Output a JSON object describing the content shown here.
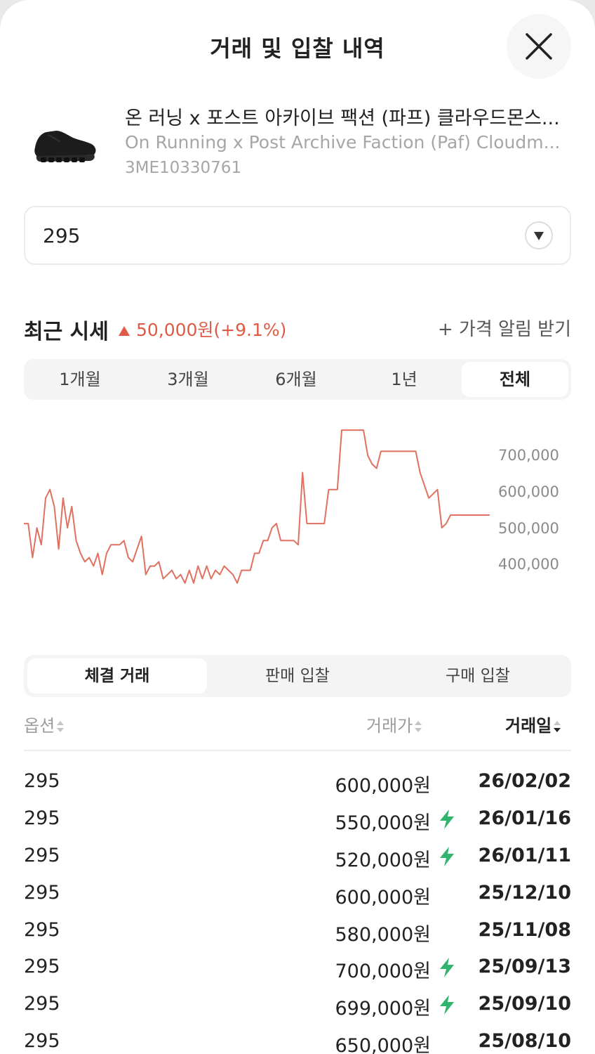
{
  "header": {
    "title": "거래 및 입찰 내역",
    "close_icon": "close-icon"
  },
  "product": {
    "name_ko": "온 러닝 x 포스트 아카이브 팩션 (파프) 클라우드몬스...",
    "name_en": "On Running x Post Archive Faction (Paf) Cloudm...",
    "model_code": "3ME10330761",
    "image": "black-running-shoe"
  },
  "size_select": {
    "value": "295",
    "icon": "chevron-down-icon"
  },
  "market": {
    "label": "최근 시세",
    "change_icon": "triangle-up-icon",
    "change": "50,000원(+9.1%)",
    "change_color": "#e05a45",
    "alert_link": "+ 가격 알림 받기"
  },
  "period_tabs": [
    {
      "label": "1개월",
      "active": false
    },
    {
      "label": "3개월",
      "active": false
    },
    {
      "label": "6개월",
      "active": false
    },
    {
      "label": "1년",
      "active": false
    },
    {
      "label": "전체",
      "active": true
    }
  ],
  "chart_data": {
    "type": "line",
    "y_ticks": [
      "700,000",
      "600,000",
      "500,000",
      "400,000"
    ],
    "ylim": [
      330000,
      760000
    ],
    "color": "#e07060",
    "x": [
      0,
      1,
      2,
      3,
      4,
      5,
      6,
      7,
      8,
      9,
      10,
      11,
      12,
      13,
      14,
      15,
      16,
      17,
      18,
      19,
      20,
      21,
      22,
      23,
      24,
      25,
      26,
      27,
      28,
      29,
      30,
      31,
      32,
      33,
      34,
      35,
      36,
      37,
      38,
      39,
      40,
      41,
      42,
      43,
      44,
      45,
      46,
      47,
      48,
      49,
      50,
      51,
      52,
      53,
      54,
      55,
      56,
      57,
      58,
      59,
      60,
      61,
      62,
      63,
      64,
      65,
      66,
      67,
      68,
      69,
      70,
      71,
      72,
      73,
      74,
      75,
      76,
      77,
      78,
      79,
      80,
      81,
      82,
      83,
      84,
      85,
      86,
      87,
      88,
      89,
      90,
      91,
      92,
      93,
      94,
      95,
      96,
      97,
      98,
      99,
      100,
      101,
      102,
      103,
      104,
      105,
      106,
      107
    ],
    "values": [
      520000,
      520000,
      440000,
      510000,
      470000,
      580000,
      600000,
      560000,
      460000,
      580000,
      510000,
      560000,
      480000,
      450000,
      430000,
      440000,
      420000,
      450000,
      400000,
      450000,
      470000,
      470000,
      470000,
      480000,
      440000,
      430000,
      460000,
      490000,
      400000,
      420000,
      420000,
      430000,
      390000,
      400000,
      410000,
      390000,
      400000,
      380000,
      410000,
      380000,
      420000,
      390000,
      420000,
      390000,
      410000,
      400000,
      420000,
      410000,
      400000,
      380000,
      410000,
      410000,
      410000,
      450000,
      450000,
      480000,
      480000,
      510000,
      520000,
      480000,
      480000,
      480000,
      480000,
      470000,
      640000,
      520000,
      520000,
      520000,
      520000,
      520000,
      600000,
      600000,
      600000,
      740000,
      740000,
      740000,
      740000,
      740000,
      740000,
      680000,
      660000,
      650000,
      690000,
      690000,
      690000,
      690000,
      690000,
      690000,
      690000,
      690000,
      690000,
      640000,
      610000,
      580000,
      590000,
      600000,
      510000,
      520000,
      540000,
      540000,
      540000,
      540000,
      540000,
      540000,
      540000,
      540000,
      540000,
      540000
    ]
  },
  "list_tabs": [
    {
      "label": "체결 거래",
      "active": true
    },
    {
      "label": "판매 입찰",
      "active": false
    },
    {
      "label": "구매 입찰",
      "active": false
    }
  ],
  "table": {
    "headers": {
      "option": "옵션",
      "price": "거래가",
      "date": "거래일"
    },
    "sort_icon": "sort-icon",
    "bolt_icon": "lightning-bolt-icon",
    "bolt_color": "#31b46e",
    "rows": [
      {
        "option": "295",
        "price": "600,000원",
        "bolt": false,
        "date": "26/02/02"
      },
      {
        "option": "295",
        "price": "550,000원",
        "bolt": true,
        "date": "26/01/16"
      },
      {
        "option": "295",
        "price": "520,000원",
        "bolt": true,
        "date": "26/01/11"
      },
      {
        "option": "295",
        "price": "600,000원",
        "bolt": false,
        "date": "25/12/10"
      },
      {
        "option": "295",
        "price": "580,000원",
        "bolt": false,
        "date": "25/11/08"
      },
      {
        "option": "295",
        "price": "700,000원",
        "bolt": true,
        "date": "25/09/13"
      },
      {
        "option": "295",
        "price": "699,000원",
        "bolt": true,
        "date": "25/09/10"
      },
      {
        "option": "295",
        "price": "650,000원",
        "bolt": false,
        "date": "25/08/10"
      }
    ]
  }
}
